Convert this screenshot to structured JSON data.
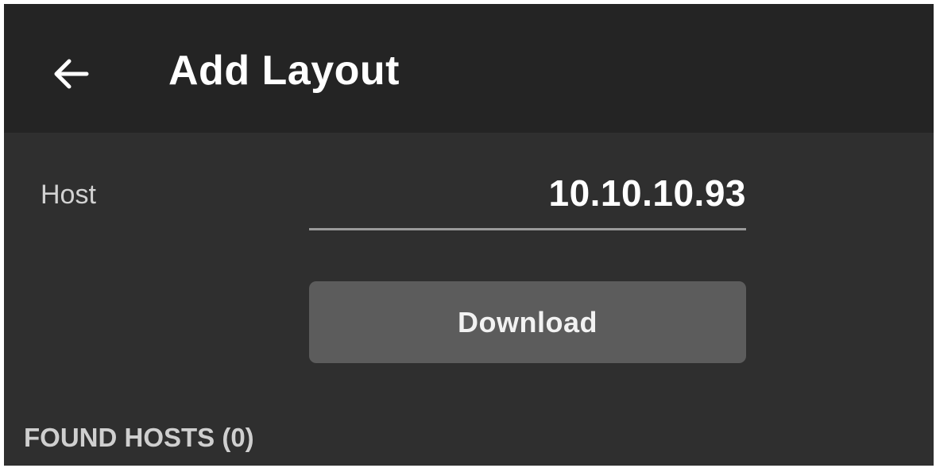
{
  "header": {
    "back_icon": "arrow-left-icon",
    "title": "Add Layout"
  },
  "form": {
    "host_label": "Host",
    "host_value": "10.10.10.93",
    "download_label": "Download"
  },
  "found_hosts": {
    "heading": "FOUND HOSTS (0)"
  },
  "colors": {
    "header_bg": "#242424",
    "body_bg": "#2f2f2f",
    "button_bg": "#5c5c5c",
    "underline": "#9a9a9a",
    "text_primary": "#ffffff",
    "text_secondary": "#d2d2d2"
  }
}
